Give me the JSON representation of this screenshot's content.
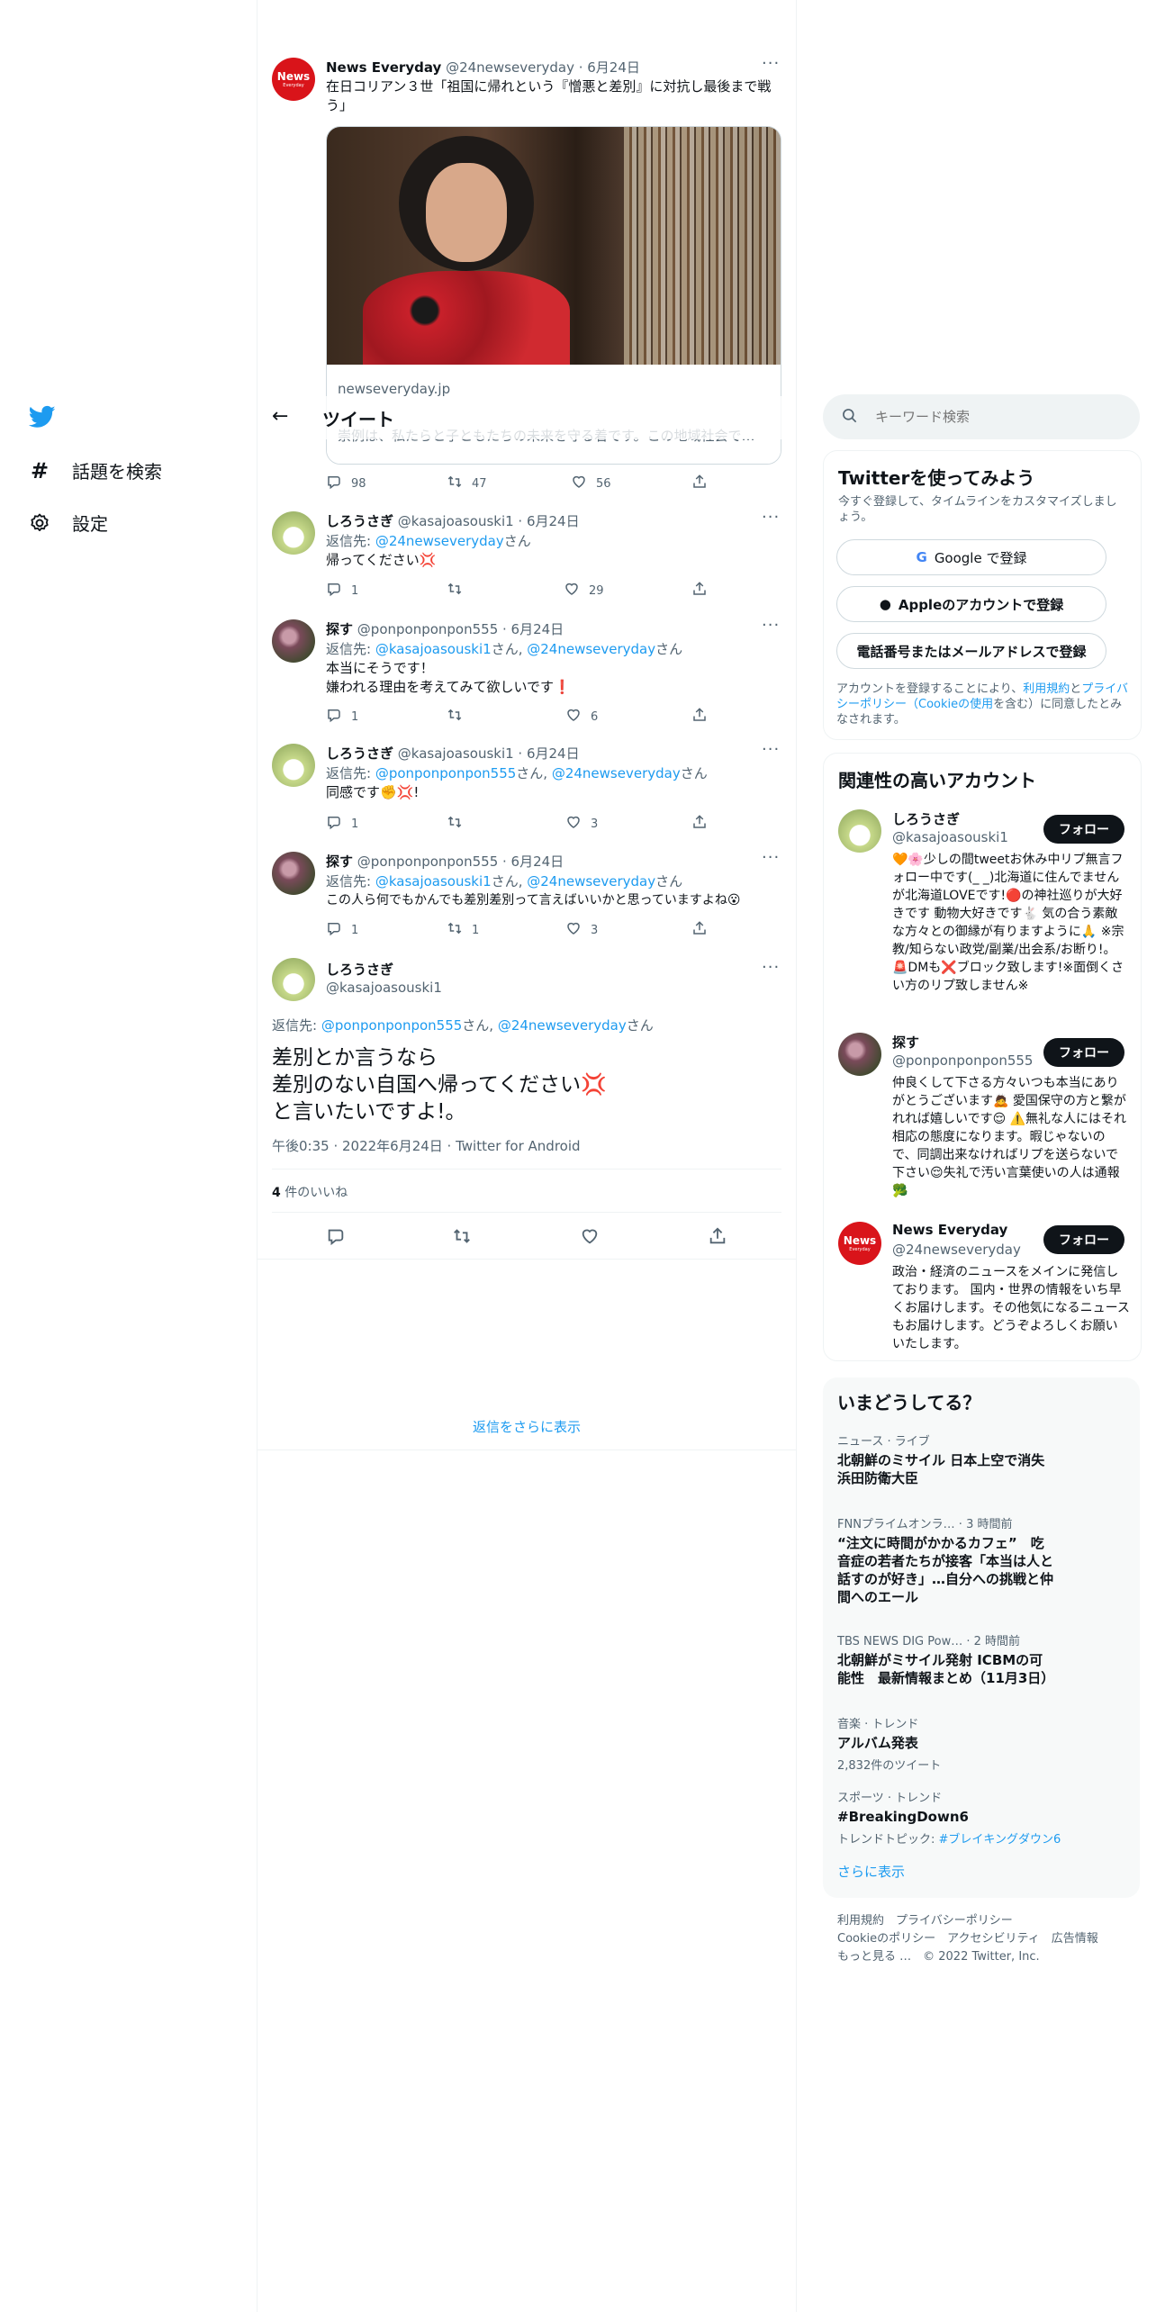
{
  "nav": {
    "logo": "twitter-bird",
    "explore": "話題を検索",
    "settings": "設定",
    "back_title": "ツイート"
  },
  "search": {
    "placeholder": "キーワード検索"
  },
  "original_tweet": {
    "name": "News Everyday",
    "handle": "@24newseveryday · 6月24日",
    "text": "在日コリアン３世「祖国に帰れという『憎悪と差別』に対抗し最後まで戦う」",
    "card_domain": "newseveryday.jp",
    "card_snippet": "崇例は、私たらと子ともたちの未来を守る着です。この地域社会で…",
    "replies": "98",
    "retweets": "47",
    "likes": "56"
  },
  "replies": [
    {
      "name": "しろうさぎ",
      "handle": "@kasajoasouski1 · 6月24日",
      "reply_prefix": "返信先: ",
      "reply_to": "@24newseveryday",
      "reply_suffix": "さん",
      "lines": [
        "帰ってください💢"
      ],
      "replies": "1",
      "retweets": "",
      "likes": "29"
    },
    {
      "name": "探す",
      "handle": "@ponponponpon555 · 6月24日",
      "reply_prefix": "返信先: ",
      "reply_to": "@kasajoasouski1",
      "reply_mid": "さん, ",
      "reply_to2": "@24newseveryday",
      "reply_suffix": "さん",
      "lines": [
        "本当にそうです！",
        "嫌われる理由を考えてみて欲しいです❗"
      ],
      "replies": "1",
      "retweets": "",
      "likes": "6"
    },
    {
      "name": "しろうさぎ",
      "handle": "@kasajoasouski1 · 6月24日",
      "reply_prefix": "返信先: ",
      "reply_to": "@ponponponpon555",
      "reply_mid": "さん, ",
      "reply_to2": "@24newseveryday",
      "reply_suffix": "さん",
      "lines": [
        "同感です✊💢!"
      ],
      "replies": "1",
      "retweets": "",
      "likes": "3"
    },
    {
      "name": "探す",
      "handle": "@ponponponpon555 · 6月24日",
      "reply_prefix": "返信先: ",
      "reply_to": "@kasajoasouski1",
      "reply_mid": "さん, ",
      "reply_to2": "@24newseveryday",
      "reply_suffix": "さん",
      "lines": [
        "この人ら何でもかんでも差別差別って言えばいいかと思っていますよね😮"
      ],
      "replies": "1",
      "retweets": "1",
      "likes": "3"
    }
  ],
  "main_tweet": {
    "name": "しろうさぎ",
    "handle": "@kasajoasouski1",
    "reply_prefix": "返信先: ",
    "reply_to": "@ponponponpon555",
    "reply_mid": "さん, ",
    "reply_to2": "@24newseveryday",
    "reply_suffix": "さん",
    "lines": [
      "差別とか言うなら",
      "差別のない自国へ帰ってください💢",
      "と言いたいですよ!。"
    ],
    "timestamp": "午後0:35 · 2022年6月24日 · Twitter for Android",
    "likes_count": "4",
    "likes_label": " 件のいいね"
  },
  "show_more_replies": "返信をさらに表示",
  "signup": {
    "title": "Twitterを使ってみよう",
    "subtitle": "今すぐ登録して、タイムラインをカスタマイズしましょう。",
    "google": "Google で登録",
    "apple": "Appleのアカウントで登録",
    "phone": "電話番号またはメールアドレスで登録",
    "legal_1": "アカウントを登録することにより、",
    "legal_terms": "利用規約",
    "legal_2": "と",
    "legal_privacy": "プライバシーポリシー（Cookieの使用",
    "legal_3": "を含む）に同意したとみなされます。"
  },
  "related": {
    "title": "関連性の高いアカウント",
    "follow_label": "フォロー",
    "accounts": [
      {
        "name": "しろうさぎ",
        "handle": "@kasajoasouski1",
        "bio": "🧡🌸少しの間tweetお休み中リプ無言フォロー中です(_ _)北海道に住んでませんが北海道LOVEです!🔴の神社巡りが大好きです 動物大好きです🐇 気の合う素敵な方々との御縁が有りますように🙏 ※宗教/知らない政党/副業/出会系/お断り!。🚨DMも❌ブロック致します!※面倒くさい方のリプ致しません※"
      },
      {
        "name": "探す",
        "handle": "@ponponponpon555",
        "bio": "仲良くして下さる方々いつも本当にありがとうございます🙇 愛国保守の方と繋がれれば嬉しいです😌 ⚠️無礼な人にはそれ相応の態度になります。暇じゃないので、同調出来なければリプを送らないで下さい😌失礼で汚い言葉使いの人は通報🥦"
      },
      {
        "name": "News Everyday",
        "handle": "@24newseveryday",
        "bio": "政治・経済のニュースをメインに発信しております。 国内・世界の情報をいち早くお届けします。その他気になるニュースもお届けします。どうぞよろしくお願いいたします。"
      }
    ]
  },
  "trends": {
    "title": "いまどうしてる？",
    "items": [
      {
        "meta": "ニュース · ライブ",
        "title": "北朝鮮のミサイル 日本上空で消失　浜田防衛大臣"
      },
      {
        "meta": "FNNプライムオンラ… · 3 時間前",
        "title": "“注文に時間がかかるカフェ”　吃音症の若者たちが接客「本当は人と話すのが好き」…自分への挑戦と仲間へのエール"
      },
      {
        "meta": "TBS NEWS DIG Pow… · 2 時間前",
        "title": "北朝鮮がミサイル発射 ICBMの可能性　最新情報まとめ（11月3日）"
      },
      {
        "meta": "音楽 · トレンド",
        "title": "アルバム発表",
        "sub": "2,832件のツイート"
      },
      {
        "meta": "スポーツ · トレンド",
        "title": "#BreakingDown6",
        "sub_prefix": "トレンドトピック: ",
        "sub_link": "#ブレイキングダウン6"
      }
    ],
    "show_more": "さらに表示"
  },
  "footer": {
    "line1": "利用規約　プライバシーポリシー",
    "line2": "Cookieのポリシー　アクセシビリティ　広告情報",
    "line3": "もっと見る …　© 2022 Twitter, Inc."
  },
  "colors": {
    "accent": "#1d9bf0",
    "text": "#0f1419",
    "muted": "#536471"
  }
}
